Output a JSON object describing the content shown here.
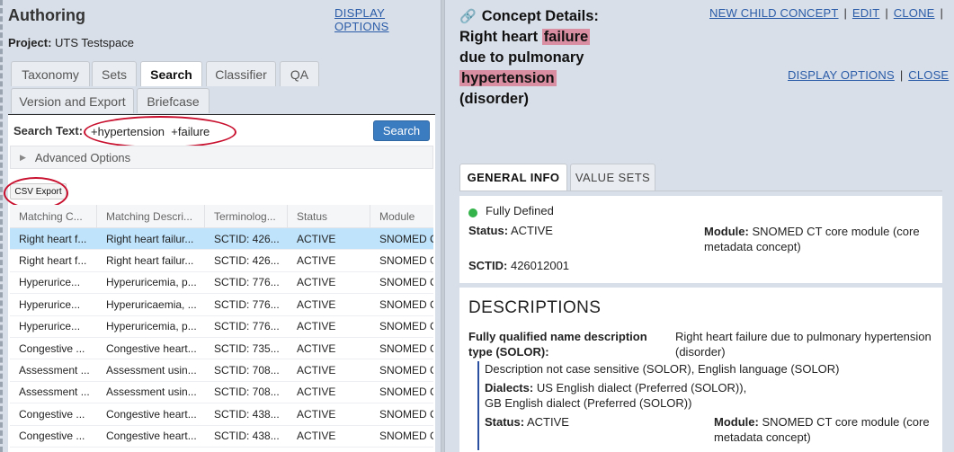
{
  "left": {
    "title": "Authoring",
    "display_options": "DISPLAY OPTIONS",
    "project_label": "Project:",
    "project_value": "UTS Testspace",
    "tabs": [
      "Taxonomy",
      "Sets",
      "Search",
      "Classifier",
      "QA",
      "Version and Export",
      "Briefcase"
    ],
    "active_tab": "Search",
    "search": {
      "label": "Search Text:",
      "value": "+hypertension  +failure",
      "button": "Search",
      "advanced": "Advanced Options",
      "csv_export": "CSV Export"
    },
    "grid": {
      "columns": [
        "Matching C...",
        "Matching Descri...",
        "Terminolog...",
        "Status",
        "Module"
      ],
      "rows": [
        [
          "Right heart f...",
          "Right heart failur...",
          "SCTID: 426...",
          "ACTIVE",
          "SNOMED C..."
        ],
        [
          "Right heart f...",
          "Right heart failur...",
          "SCTID: 426...",
          "ACTIVE",
          "SNOMED C..."
        ],
        [
          "Hyperurice...",
          "Hyperuricemia, p...",
          "SCTID: 776...",
          "ACTIVE",
          "SNOMED C..."
        ],
        [
          "Hyperurice...",
          "Hyperuricaemia, ...",
          "SCTID: 776...",
          "ACTIVE",
          "SNOMED C..."
        ],
        [
          "Hyperurice...",
          "Hyperuricemia, p...",
          "SCTID: 776...",
          "ACTIVE",
          "SNOMED C..."
        ],
        [
          "Congestive ...",
          "Congestive heart...",
          "SCTID: 735...",
          "ACTIVE",
          "SNOMED C..."
        ],
        [
          "Assessment ...",
          "Assessment usin...",
          "SCTID: 708...",
          "ACTIVE",
          "SNOMED C..."
        ],
        [
          "Assessment ...",
          "Assessment usin...",
          "SCTID: 708...",
          "ACTIVE",
          "SNOMED C..."
        ],
        [
          "Congestive ...",
          "Congestive heart...",
          "SCTID: 438...",
          "ACTIVE",
          "SNOMED C..."
        ],
        [
          "Congestive ...",
          "Congestive heart...",
          "SCTID: 438...",
          "ACTIVE",
          "SNOMED C..."
        ]
      ],
      "selected_row": 0
    }
  },
  "right": {
    "title_prefix": "Concept Details: Right heart",
    "title_hl1": "failure",
    "title_mid": "due to pulmonary",
    "title_hl2": "hypertension",
    "title_suffix": "(disorder)",
    "highlight_color": "#d98fa1",
    "links": {
      "new_child": "NEW CHILD CONCEPT",
      "edit": "EDIT",
      "clone": "CLONE",
      "display_options": "DISPLAY OPTIONS",
      "close": "CLOSE",
      "separator": "|"
    },
    "tabs": [
      "GENERAL INFO",
      "VALUE SETS"
    ],
    "info": {
      "definition": "Fully Defined",
      "status_label": "Status:",
      "status_value": "ACTIVE",
      "module_label": "Module:",
      "module_value": "SNOMED CT core module (core metadata concept)",
      "sctid_label": "SCTID:",
      "sctid_value": "426012001"
    },
    "descriptions": {
      "heading": "DESCRIPTIONS",
      "fqn_label": "Fully qualified name description type (SOLOR):",
      "fqn_value": "Right heart failure due to pulmonary hypertension (disorder)",
      "case_text": "Description not case sensitive (SOLOR), English language (SOLOR)",
      "dialects_label": "Dialects:",
      "dialects_value": "US English dialect (Preferred (SOLOR)),",
      "dialects_value2": "GB English dialect (Preferred (SOLOR))",
      "status_label": "Status:",
      "status_value": "ACTIVE",
      "module_label": "Module:",
      "module_value": "SNOMED CT core module (core metadata concept)"
    }
  }
}
